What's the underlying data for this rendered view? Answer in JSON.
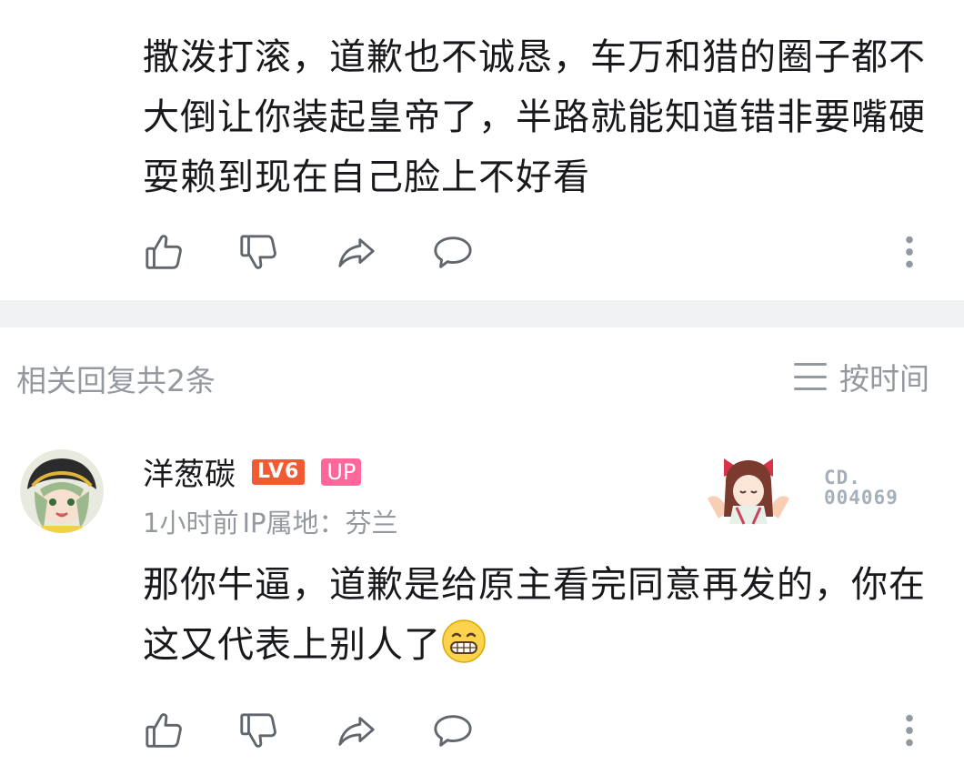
{
  "root_comment": {
    "text": "撒泼打滚，道歉也不诚恳，车万和猎的圈子都不大倒让你装起皇帝了，半路就能知道错非要嘴硬耍赖到现在自己脸上不好看",
    "actions": {
      "like_icon": "thumbs-up-icon",
      "dislike_icon": "thumbs-down-icon",
      "share_icon": "share-icon",
      "comment_icon": "comment-icon",
      "more_icon": "more-vertical-icon"
    }
  },
  "replies_header": {
    "count_label": "相关回复共2条",
    "sort_label": "按时间",
    "sort_icon": "menu-lines-icon"
  },
  "reply": {
    "username": "洋葱碳",
    "level_badge": "LV6",
    "up_badge": "UP",
    "time": "1小时前",
    "ip_location": "IP属地：芬兰",
    "decoration_label_line1": "CD.",
    "decoration_label_line2": "004069",
    "text": "那你牛逼，道歉是给原主看完同意再发的，你在这又代表上别人了",
    "emoji": "grinning-face-icon"
  },
  "colors": {
    "text_primary": "#18191c",
    "text_secondary": "#9499a0",
    "divider": "#f1f2f3",
    "level_badge": "#f05b34",
    "up_badge": "#ff6699",
    "icon_stroke": "#61666d"
  }
}
